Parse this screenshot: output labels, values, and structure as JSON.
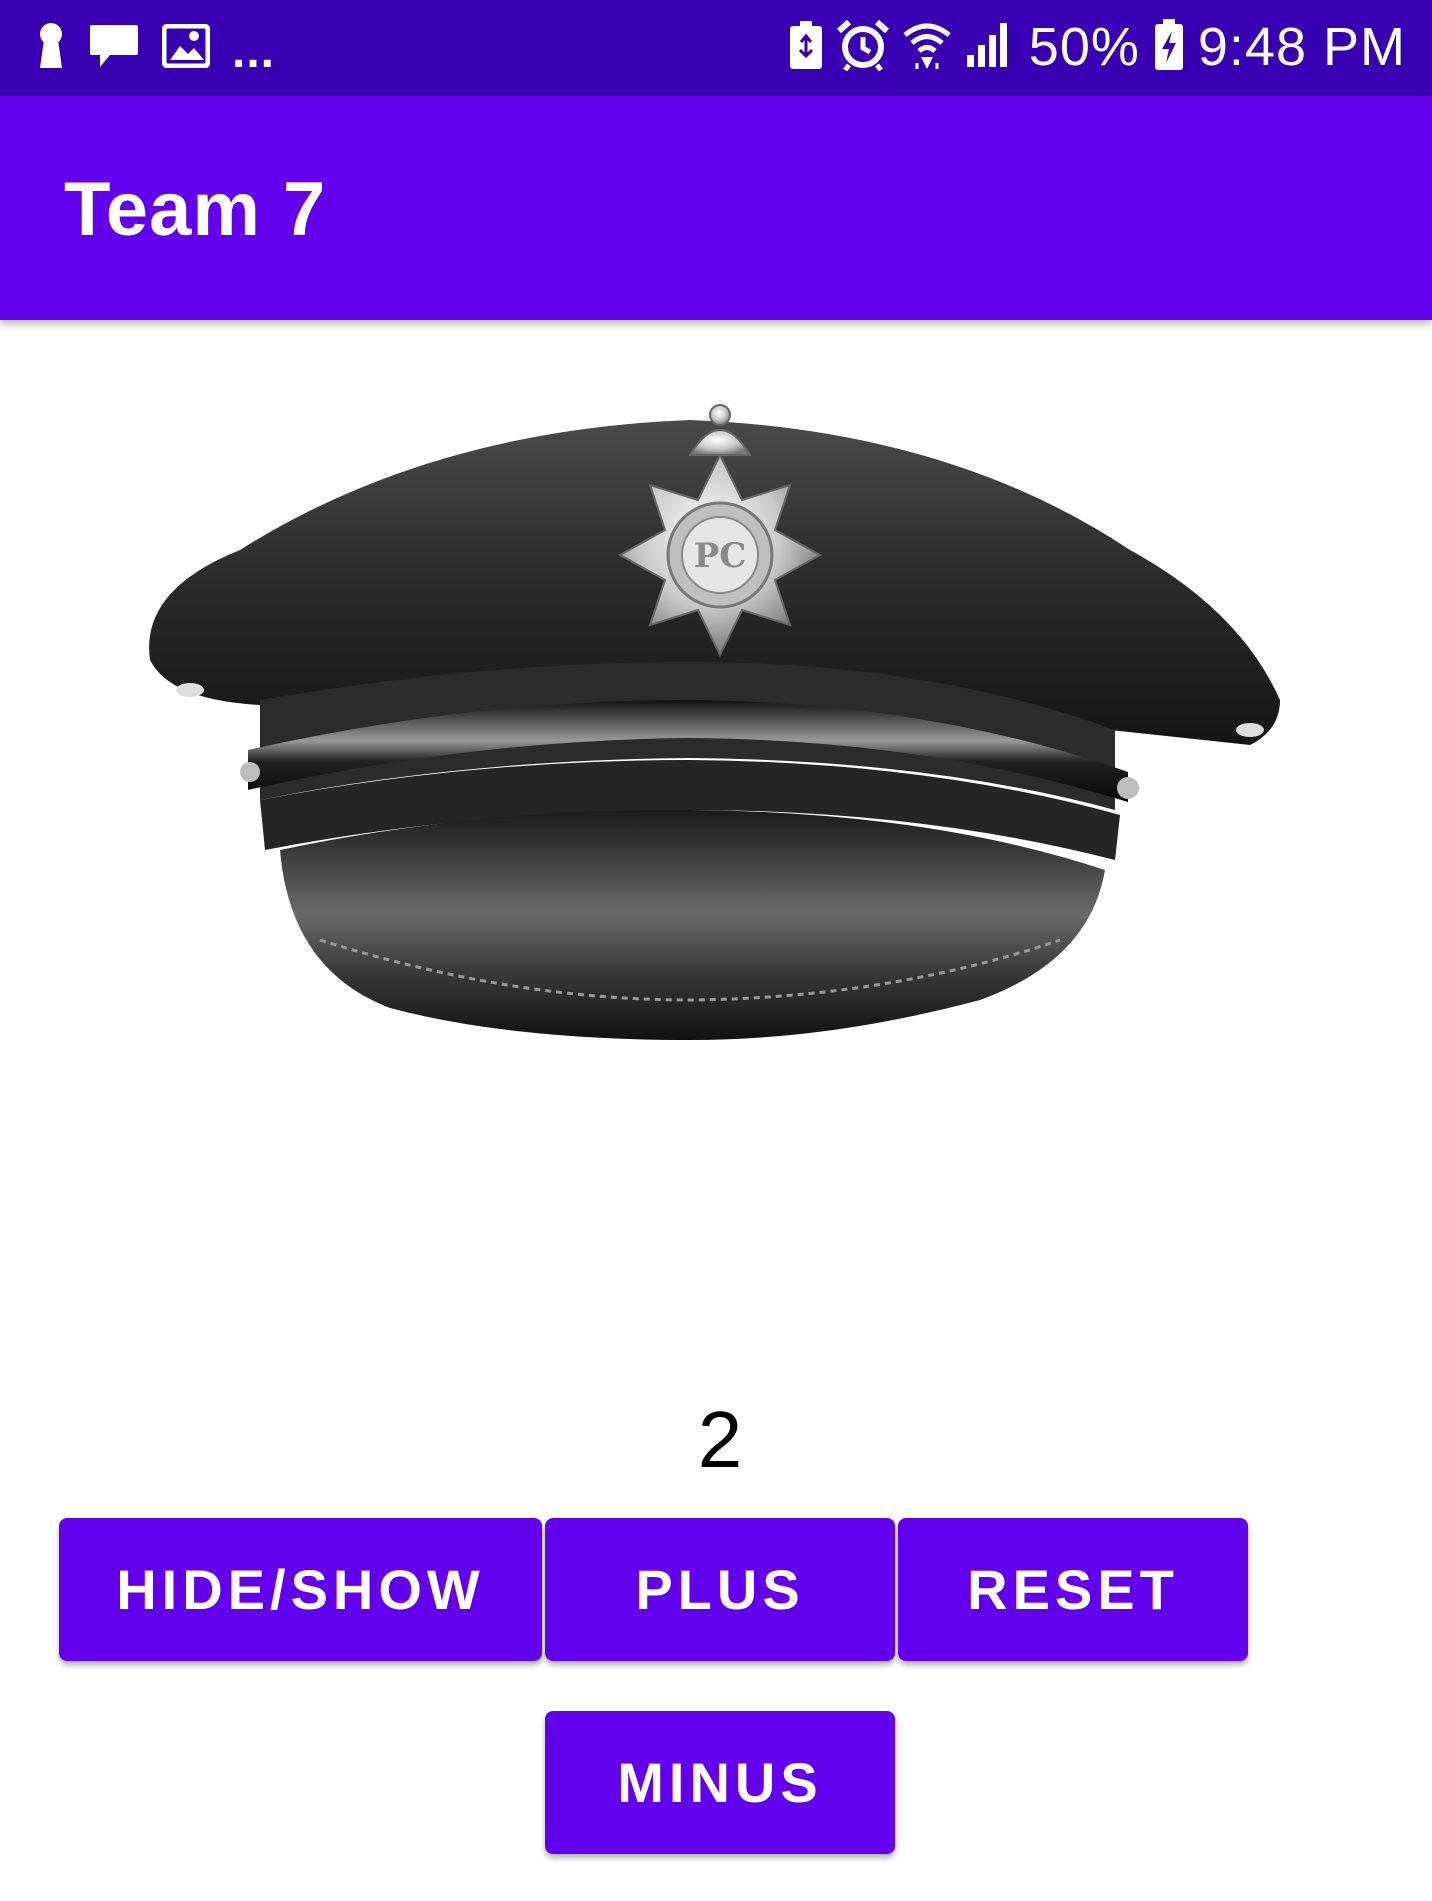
{
  "status_bar": {
    "battery_percent": "50%",
    "time": "9:48 PM",
    "overflow": "...",
    "left_icons": [
      "keyhole-icon",
      "message-icon",
      "image-icon"
    ],
    "right_icons": [
      "battery-saver-icon",
      "alarm-icon",
      "wifi-icon",
      "signal-icon",
      "battery-charging-icon"
    ]
  },
  "app_bar": {
    "title": "Team 7",
    "color": "#6200ee"
  },
  "main": {
    "image": "police-hat-image",
    "counter": "2"
  },
  "buttons": {
    "hide_show": "HIDE/SHOW",
    "plus": "PLUS",
    "reset": "RESET",
    "minus": "MINUS"
  },
  "colors": {
    "status_bar": "#3700b3",
    "primary": "#6200ee",
    "background": "#ffffff"
  }
}
